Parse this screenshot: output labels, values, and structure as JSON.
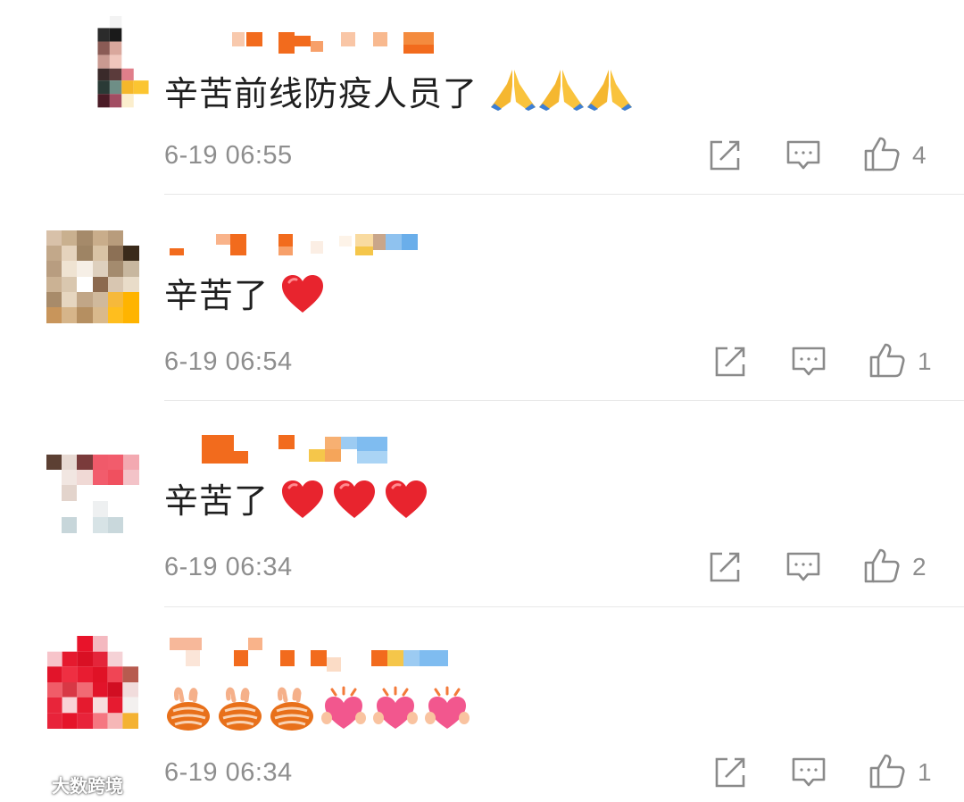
{
  "comments": [
    {
      "text": "辛苦前线防疫人员了",
      "emoji": [
        "folded-hands",
        "folded-hands",
        "folded-hands"
      ],
      "time": "6-19 06:55",
      "likes": "4"
    },
    {
      "text": "辛苦了",
      "emoji": [
        "red-heart"
      ],
      "time": "6-19 06:54",
      "likes": "1"
    },
    {
      "text": "辛苦了",
      "emoji": [
        "red-heart",
        "red-heart",
        "red-heart"
      ],
      "time": "6-19 06:34",
      "likes": "2"
    },
    {
      "text": "",
      "emoji": [
        "bunny-hands",
        "bunny-hands",
        "bunny-hands",
        "heart-hands",
        "heart-hands",
        "heart-hands"
      ],
      "time": "6-19 06:34",
      "likes": "1"
    }
  ],
  "icons": {
    "share": "share-icon",
    "reply": "comment-icon",
    "like": "thumbs-up-icon"
  },
  "colors": {
    "text": "#1f1f1f",
    "meta": "#8e8e8e",
    "divider": "#e8e8e8",
    "icon": "#8a8a8a",
    "accent_orange": "#f26b1d",
    "heart_red": "#e8242e"
  },
  "watermark": {
    "text": "大数跨境"
  }
}
